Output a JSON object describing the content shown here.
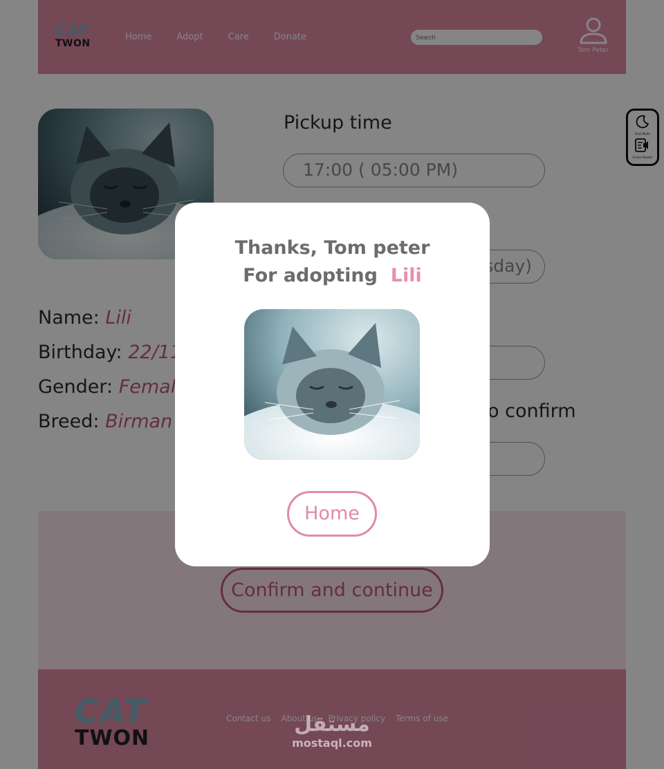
{
  "header": {
    "logo_top": "CAT",
    "logo_bottom": "TWON",
    "nav": [
      "Home",
      "Adopt",
      "Care",
      "Donate"
    ],
    "search_placeholder": "Search",
    "user_name": "Tom Peter",
    "user_icon": "user-icon"
  },
  "accessibility": {
    "dark_mode_label": "Dark Mode",
    "dark_mode_icon": "moon-icon",
    "screen_reader_label": "Screen Reader",
    "screen_reader_icon": "screen-reader-icon"
  },
  "pet": {
    "name_label": "Name:",
    "name": "Lili",
    "birthday_label": "Birthday:",
    "birthday": "22/11/",
    "gender_label": "Gender:",
    "gender": "Femal",
    "breed_label": "Breed:",
    "breed": "Birman"
  },
  "form": {
    "pickup_time_title": "Pickup time",
    "pickup_time_value": "17:00 ( 05:00 PM)",
    "pickup_day_value": "sday)",
    "confirm_title": "o confirm",
    "confirm_button": "Confirm and continue"
  },
  "modal": {
    "line1": "Thanks, Tom peter",
    "line2": "For adopting",
    "cat_name": "Lili",
    "home_button": "Home"
  },
  "footer": {
    "logo_top": "CAT",
    "logo_bottom": "TWON",
    "links": [
      "Contact us",
      "About us",
      "Privacy policy",
      "Terms of use"
    ]
  },
  "watermark": {
    "arabic": "مستقل",
    "latin": "mostaql.com"
  },
  "colors": {
    "brand_pink": "#e08aa6",
    "accent_pink": "#c2567c",
    "logo_blue": "#7fb3c8"
  }
}
